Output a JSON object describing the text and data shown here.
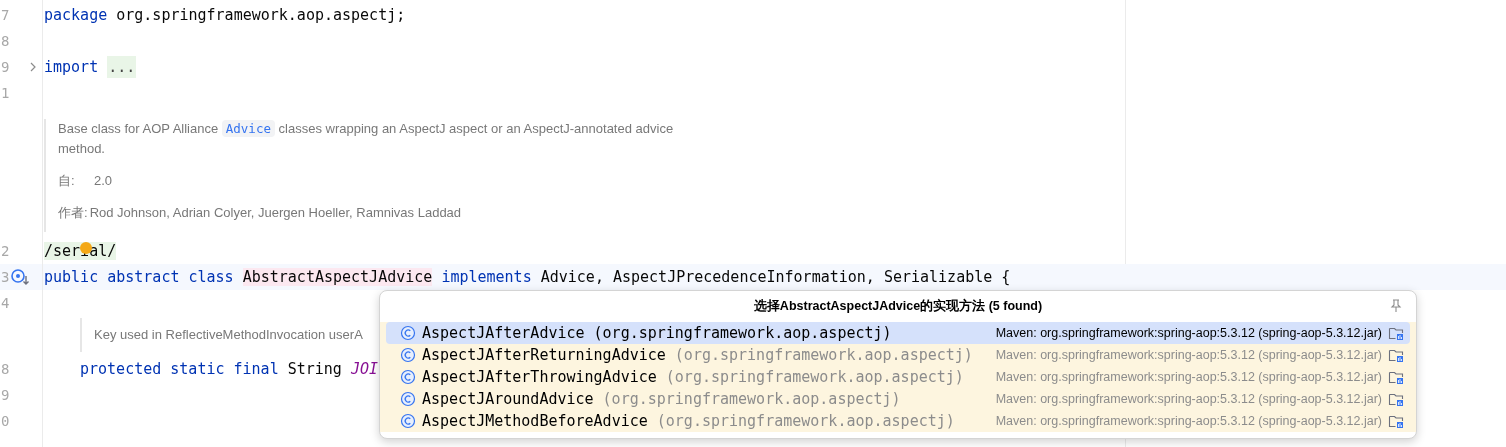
{
  "editor": {
    "lines": [
      {
        "kind": "code",
        "number": "7",
        "tokens": [
          {
            "text": "package",
            "kind": "keyword"
          },
          {
            "text": "org.springframework.aop.aspectj;",
            "kind": "plain"
          }
        ]
      },
      {
        "kind": "blank",
        "number": "8"
      },
      {
        "kind": "code",
        "number": "9",
        "collapsed": true,
        "tokens": [
          {
            "text": "import",
            "kind": "keyword"
          }
        ],
        "fold_placeholder": "..."
      },
      {
        "kind": "blank",
        "number": "1"
      },
      {
        "kind": "doc",
        "paragraphs": [
          {
            "kind": "text",
            "parts": [
              {
                "text": "Base class for AOP Alliance ",
                "kind": "plain"
              },
              {
                "text": "Advice",
                "kind": "code"
              },
              {
                "text": " classes wrapping an AspectJ aspect or an AspectJ-annotated advice method.",
                "kind": "plain"
              }
            ]
          },
          {
            "kind": "tag",
            "label": "自:",
            "value": "2.0"
          },
          {
            "kind": "tag",
            "label": "作者:",
            "value": "Rod Johnson, Adrian Colyer, Juergen Hoeller, Ramnivas Laddad"
          }
        ]
      },
      {
        "kind": "code",
        "number": "2",
        "intention": true,
        "tokens": [
          {
            "text": "/serial/",
            "kind": "annotation"
          }
        ]
      },
      {
        "kind": "code",
        "number": "3",
        "current": true,
        "implemented": true,
        "tokens": [
          {
            "text": "public",
            "kind": "keyword"
          },
          {
            "text": "abstract",
            "kind": "keyword"
          },
          {
            "text": "class",
            "kind": "keyword"
          },
          {
            "text": "AbstractAspectJAdvice",
            "kind": "declaration"
          },
          {
            "text": "implements",
            "kind": "keyword"
          },
          {
            "text": "Advice,",
            "kind": "plain"
          },
          {
            "text": "AspectJPrecedenceInformation,",
            "kind": "plain"
          },
          {
            "text": "Serializable",
            "kind": "plain"
          },
          {
            "text": "{",
            "kind": "plain"
          }
        ],
        "children": [
          {
            "kind": "blank",
            "number": "4"
          },
          {
            "kind": "doc",
            "paragraphs": [
              {
                "kind": "text",
                "parts": [
                  {
                    "text": "Key used in ReflectiveMethodInvocation userA",
                    "kind": "plain"
                  }
                ]
              }
            ]
          },
          {
            "kind": "code",
            "number": "8",
            "tokens": [
              {
                "text": "protected",
                "kind": "keyword"
              },
              {
                "text": "static",
                "kind": "keyword"
              },
              {
                "text": "final",
                "kind": "keyword"
              },
              {
                "text": "String",
                "kind": "plain"
              },
              {
                "text": "JOI",
                "kind": "constant"
              }
            ]
          },
          {
            "kind": "blank",
            "number": "9"
          },
          {
            "kind": "blank",
            "number": "0"
          }
        ]
      }
    ]
  },
  "popup": {
    "title": "选择AbstractAspectJAdvice的实现方法 (5 found)",
    "items": [
      {
        "name": "AspectJAfterAdvice",
        "package": "(org.springframework.aop.aspectj)",
        "location": "Maven: org.springframework:spring-aop:5.3.12 (spring-aop-5.3.12.jar)",
        "selected": true
      },
      {
        "name": "AspectJAfterReturningAdvice",
        "package": "(org.springframework.aop.aspectj)",
        "location": "Maven: org.springframework:spring-aop:5.3.12 (spring-aop-5.3.12.jar)",
        "selected": false
      },
      {
        "name": "AspectJAfterThrowingAdvice",
        "package": "(org.springframework.aop.aspectj)",
        "location": "Maven: org.springframework:spring-aop:5.3.12 (spring-aop-5.3.12.jar)",
        "selected": false
      },
      {
        "name": "AspectJAroundAdvice",
        "package": "(org.springframework.aop.aspectj)",
        "location": "Maven: org.springframework:spring-aop:5.3.12 (spring-aop-5.3.12.jar)",
        "selected": false
      },
      {
        "name": "AspectJMethodBeforeAdvice",
        "package": "(org.springframework.aop.aspectj)",
        "location": "Maven: org.springframework:spring-aop:5.3.12 (spring-aop-5.3.12.jar)",
        "selected": false
      }
    ]
  }
}
